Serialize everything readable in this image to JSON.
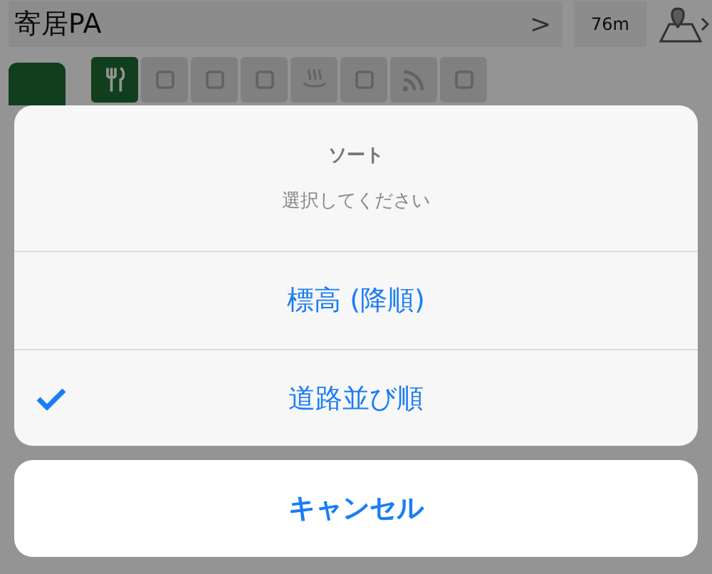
{
  "header": {
    "title": "寄居PA",
    "chevron": ">",
    "distance": "76m"
  },
  "facilities": [
    {
      "kind": "restaurant",
      "on": true
    },
    {
      "kind": "fastfood",
      "on": false
    },
    {
      "kind": "store24",
      "on": false
    },
    {
      "kind": "shower",
      "on": false
    },
    {
      "kind": "bath",
      "on": false
    },
    {
      "kind": "laundry",
      "on": false
    },
    {
      "kind": "wifi",
      "on": false
    },
    {
      "kind": "fuel",
      "on": false
    }
  ],
  "sheet": {
    "title": "ソート",
    "message": "選択してください",
    "options": [
      {
        "label": "標高 (降順)",
        "selected": false
      },
      {
        "label": "道路並び順",
        "selected": true
      }
    ],
    "cancel": "キャンセル"
  }
}
